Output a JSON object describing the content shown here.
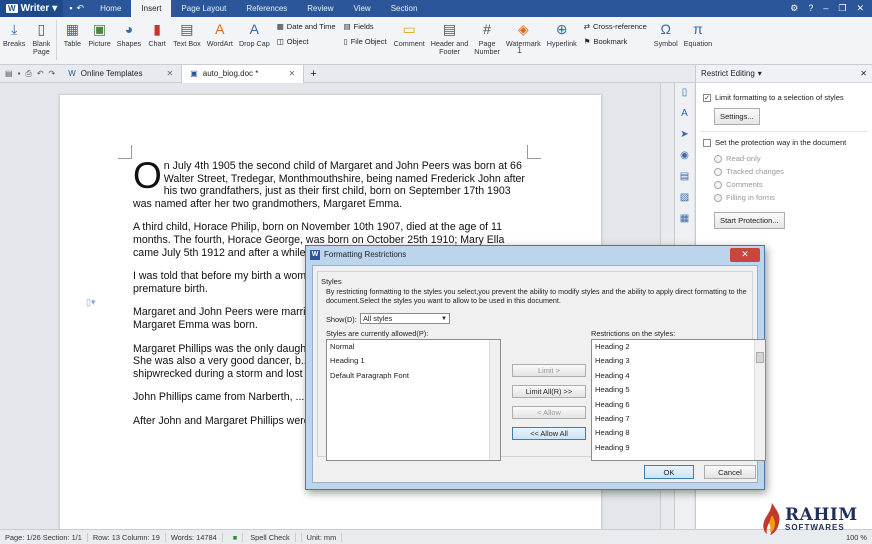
{
  "app": {
    "name": "Writer"
  },
  "menu": {
    "tabs": [
      "Home",
      "Insert",
      "Page Layout",
      "References",
      "Review",
      "View",
      "Section"
    ],
    "active": "Insert"
  },
  "ribbon": {
    "breaks": "Breaks",
    "blank_page": "Blank\nPage",
    "table": "Table",
    "picture": "Picture",
    "shapes": "Shapes",
    "chart": "Chart",
    "text_box": "Text Box",
    "wordart": "WordArt",
    "drop_cap": "Drop Cap",
    "date_time": "Date and Time",
    "object": "Object",
    "fields": "Fields",
    "file_object": "File Object",
    "comment": "Comment",
    "header_footer": "Header and\nFooter",
    "page_number": "Page\nNumber",
    "watermark": "Watermark",
    "hyperlink": "Hyperlink",
    "cross_reference": "Cross-reference",
    "bookmark": "Bookmark",
    "symbol": "Symbol",
    "equation": "Equation"
  },
  "tabs": [
    {
      "label": "Online Templates"
    },
    {
      "label": "auto_biog.doc *"
    }
  ],
  "document": {
    "page_number": "1",
    "drop_cap": "O",
    "p1": "n July 4th 1905 the second child of Margaret and John Peers was born at 66 Walter Street, Tredegar, Monthmouthshire, being named Frederick John after his two grandfathers, just as their first child, born on September 17th 1903 was named after her two grandmothers, Margaret Emma.",
    "p2": "A third child, Horace Philip, born on November 10th 1907, died at the age of 11 months. The fourth, Horace George, was born on October 25th 1910; Mary Ella came July 5th 1912 and after a while ... October 27th 1919.",
    "p3": "I was told that before my birth a woman ... dark and stabbed my mother in the ... premature birth.",
    "p4": "Margaret and John Peers were married ... lived for a time at Margaret's parents ... Margaret Emma was born.",
    "p5": "Margaret Phillips was the only daughter ... of Dublin and was reputed to be the ... She was also a very good dancer, b... Liverpool by their parents with friends ... shipwrecked during a storm and lost ... Lowe.",
    "p6": "John Phillips came from Narberth, ... where members of his family still live.",
    "p7": "After John and Margaret Phillips were married they lived at a farm near"
  },
  "panel": {
    "title": "Restrict Editing",
    "limit_formatting": "Limit formatting to a selection of styles",
    "settings_btn": "Settings...",
    "set_protection": "Set the protection way in the document",
    "radios": [
      "Read-only",
      "Tracked changes",
      "Comments",
      "Filling in forms"
    ],
    "start_btn": "Start Protection..."
  },
  "dialog": {
    "title": "Formatting Restrictions",
    "group": "Styles",
    "description": "By restricting formatting to the styles you select,you prevent the ability to modify styles and the ability to apply direct formatting to the document.Select the styles you want to allow to be used in this document.",
    "show_label": "Show(D):",
    "show_value": "All styles",
    "allowed_label": "Styles are currently allowed(P):",
    "allowed": [
      "Normal",
      "Heading 1",
      "Default Paragraph Font"
    ],
    "restrictions_label": "Restrictions on the styles:",
    "restricted": [
      "Heading 2",
      "Heading 3",
      "Heading 4",
      "Heading 5",
      "Heading 6",
      "Heading 7",
      "Heading 8",
      "Heading 9"
    ],
    "limit_btn": "Limit >",
    "limit_all_btn": "Limit All(R) >>",
    "allow_btn": "< Allow",
    "allow_all_btn": "<< Allow All",
    "ok": "OK",
    "cancel": "Cancel"
  },
  "status": {
    "page": "Page: 1/26 Section: 1/1",
    "row_col": "Row: 13 Column: 19",
    "words": "Words: 14784",
    "spell": "Spell Check",
    "unit": "Unit: mm",
    "zoom": "100 %"
  },
  "watermark": {
    "big": "RAHIM",
    "small": "SOFTWARES"
  },
  "colors": {
    "accent": "#2b579a",
    "dialog_frame": "#bcd4ec",
    "close": "#c9463d"
  }
}
